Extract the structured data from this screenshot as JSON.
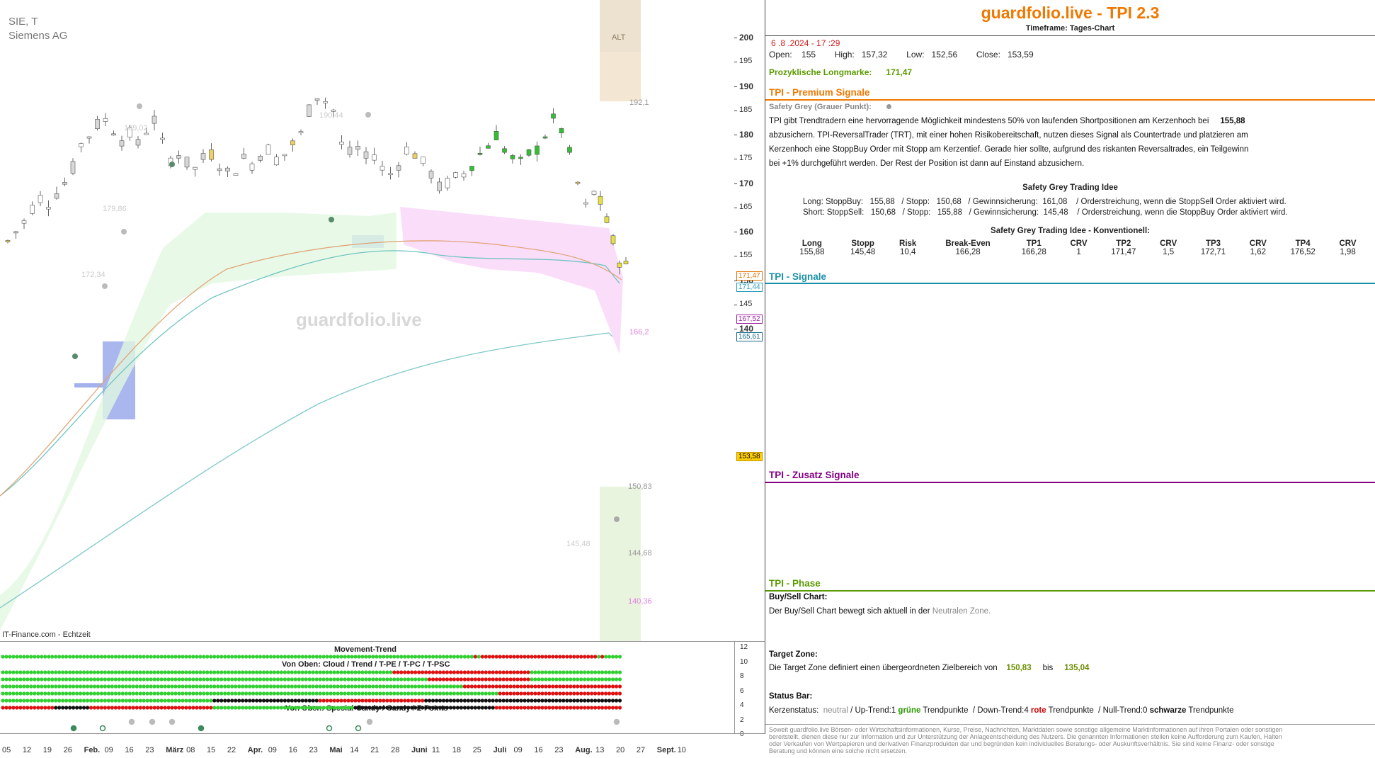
{
  "chart": {
    "symbol": "SIE, T",
    "company": "Siemens AG",
    "watermark": "guardfolio.live",
    "source": "IT-Finance.com - Echtzeit",
    "alt_label": "ALT",
    "price_ticks": [
      "200",
      "195",
      "190",
      "185",
      "180",
      "175",
      "170",
      "165",
      "160",
      "155",
      "150",
      "145",
      "140"
    ],
    "date_ticks": [
      "05",
      "12",
      "19",
      "26",
      "Feb.",
      "09",
      "16",
      "23",
      "März",
      "08",
      "15",
      "22",
      "Apr.",
      "09",
      "16",
      "23",
      "Mai",
      "14",
      "21",
      "28",
      "Juni",
      "11",
      "18",
      "25",
      "Juli",
      "09",
      "16",
      "23",
      "Aug.",
      "13",
      "20",
      "27",
      "Sept.",
      "10"
    ],
    "annotations": [
      "189,02",
      "190,44",
      "179,86",
      "172,34",
      "192,1",
      "166,2",
      "150,83",
      "145,48",
      "144,68",
      "140,36"
    ],
    "price_tags": [
      {
        "value": "171,47",
        "color": "#e07000"
      },
      {
        "value": "171,44",
        "color": "#2aa0b8"
      },
      {
        "value": "167,52",
        "color": "#a020a0"
      },
      {
        "value": "165,61",
        "color": "#1a6a8a"
      },
      {
        "value": "153,58",
        "color": "#d4a000"
      }
    ],
    "bottom_labels": [
      "Movement-Trend",
      "Von Oben: Cloud / Trend / T-PE / T-PC / T-PSC",
      "Von Oben: Special-Candy / Candy / Z-Points"
    ],
    "bottom_ticks": [
      "12",
      "10",
      "8",
      "6",
      "4",
      "2",
      "0"
    ]
  },
  "panel": {
    "title": "guardfolio.live - TPI 2.3",
    "timeframe": "Timeframe: Tages-Chart",
    "datetime": "6 .8 .2024 - 17 :29",
    "ohlc": {
      "open_label": "Open:",
      "open": "155",
      "high_label": "High:",
      "high": "157,32",
      "low_label": "Low:",
      "low": "152,56",
      "close_label": "Close:",
      "close": "153,59"
    },
    "longmarke_label": "Prozyklische Longmarke:",
    "longmarke_value": "171,47",
    "premium": {
      "title": "TPI - Premium Signale",
      "safety_label": "Safety Grey (Grauer Punkt):",
      "text_1": "TPI gibt Trendtradern eine hervorragende Möglichkeit mindestens 50% von laufenden Shortpositionen am Kerzenhoch bei",
      "text_1_value": "155,88",
      "text_2": "abzusichern. TPI-ReversalTrader (TRT), mit einer hohen Risikobereitschaft, nutzen dieses Signal als Countertrade und platzieren am",
      "text_3": "Kerzenhoch eine StoppBuy Order mit Stopp am Kerzentief. Gerade hier sollte, aufgrund des riskanten Reversaltrades, ein Teilgewinn",
      "text_4": "bei +1% durchgeführt werden. Der Rest der Position ist dann auf Einstand abzusichern.",
      "idea_title": "Safety Grey Trading Idee",
      "long_line": "Long: StoppBuy:   155,88   / Stopp:   150,68   / Gewinnsicherung:  161,08    / Orderstreichung, wenn die StoppSell Order aktiviert wird.",
      "short_line": "Short: StoppSell:   150,68   / Stopp:   155,88   / Gewinnsicherung:  145,48    / Orderstreichung, wenn die StoppBuy Order aktiviert wird.",
      "konv_title": "Safety Grey Trading Idee - Konventionell:",
      "konv_headers": [
        "Long",
        "Stopp",
        "Risk",
        "Break-Even",
        "TP1",
        "CRV",
        "TP2",
        "CRV",
        "TP3",
        "CRV",
        "TP4",
        "CRV"
      ],
      "konv_values": [
        "155,88",
        "145,48",
        "10,4",
        "166,28",
        "166,28",
        "1",
        "171,47",
        "1,5",
        "172,71",
        "1,62",
        "176,52",
        "1,98"
      ]
    },
    "signale_title": "TPI - Signale",
    "zusatz_title": "TPI - Zusatz Signale",
    "phase": {
      "title": "TPI - Phase",
      "buysell_label": "Buy/Sell Chart:",
      "buysell_text": "Der Buy/Sell Chart bewegt sich aktuell in der",
      "buysell_zone": "Neutralen Zone.",
      "target_label": "Target Zone:",
      "target_text": "Die Target Zone definiert einen übergeordneten Zielbereich von",
      "target_from": "150,83",
      "target_bis": "bis",
      "target_to": "135,04",
      "status_label": "Status Bar:",
      "status_prefix": "Kerzenstatus:",
      "status_neutral": "neutral",
      "status_up": " / Up-Trend:1 ",
      "status_green": "grüne",
      "status_mid1": " Trendpunkte  / Down-Trend:4 ",
      "status_red": "rote",
      "status_mid2": " Trendpunkte  / Null-Trend:0 ",
      "status_black": "schwarze",
      "status_end": " Trendpunkte"
    },
    "disclaimer": "Soweit guardfolio.live Börsen- oder Wirtschaftsinformationen, Kurse, Preise, Nachrichten, Marktdaten sowie sonstige allgemeine Marktinformationen auf ihren Portalen oder sonstigen bereitstellt, dienen diese nur zur Information und zur Unterstützung der Anlageentscheidung des Nutzers. Die genannten Informationen stellen keine Aufforderung zum Kaufen, Halten oder Verkaufen von Wertpapieren und derivativen Finanzprodukten dar und begründen kein individuelles Beratungs- oder Auskunftsverhältnis. Sie sind keine Finanz- oder sonstige Beratung und können eine solche nicht ersetzen."
  },
  "colors": {
    "orange": "#f07800",
    "teal": "#1a90a8",
    "purple": "#800080",
    "green": "#5a9a00"
  }
}
